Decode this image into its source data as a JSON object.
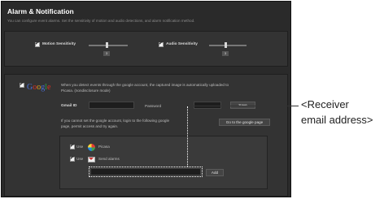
{
  "header": {
    "title": "Alarm & Notification",
    "subtitle": "You can configure event alarms. Set the sensitivity of motion and audio detections, and alarm notification method."
  },
  "sensitivity": {
    "motion_label": "Motion Sensitivity",
    "motion_value": "3",
    "audio_label": "Audio Sensitivity",
    "audio_value": "3"
  },
  "google": {
    "logo_text": "Google",
    "description_line1": "When you detect events through the google account, the captured image is automatically uploaded to",
    "description_line2": "Picasa. (nondisclosure mode)",
    "gmail_label": "Gmail ID",
    "password_label": "Password",
    "save_label": "Save",
    "help_line1": "If you cannot set the google account, login to the following google",
    "help_line2": "page, permit access and try again.",
    "goto_label": "Go to the google page",
    "use_picasa_label": "Use",
    "picasa_label": "Picasa",
    "use_alarm_label": "Use",
    "send_alarms_label": "Send alarms",
    "receiver_placeholder": "",
    "add_label": "Add"
  },
  "annotation": {
    "line1": "<Receiver",
    "line2": "email address>"
  },
  "colors": {
    "panel_bg": "#2a2a2a",
    "section_bg": "#333333",
    "google_blue": "#4a6fd8",
    "google_red": "#d93025",
    "google_yellow": "#e3a617",
    "google_green": "#2f9e44"
  }
}
